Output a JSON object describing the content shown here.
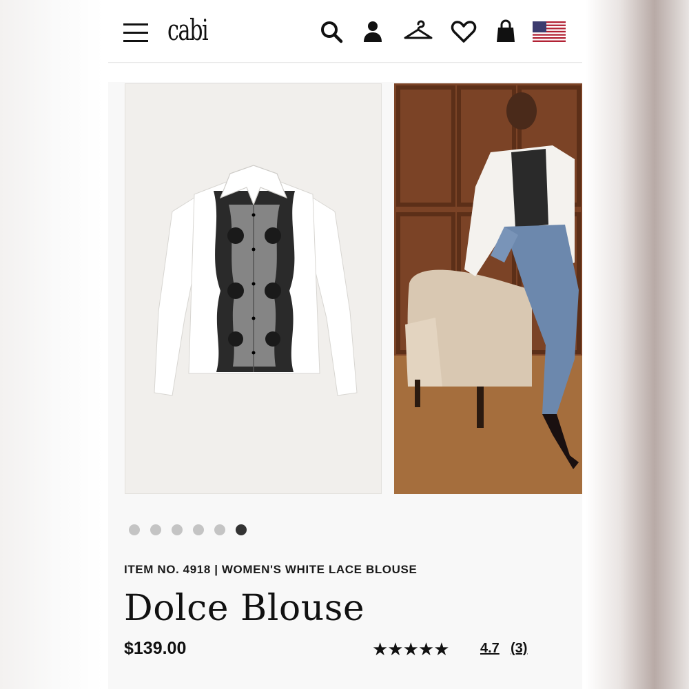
{
  "header": {
    "logo": "cabi",
    "icons": [
      "menu-icon",
      "search-icon",
      "account-icon",
      "hanger-icon",
      "wishlist-icon",
      "bag-icon",
      "us-flag-icon"
    ]
  },
  "gallery": {
    "slide_count": 6,
    "active_index": 5
  },
  "product": {
    "meta": "ITEM NO. 4918 | WOMEN'S WHITE LACE BLOUSE",
    "name": "Dolce Blouse",
    "price": "$139.00",
    "stars": "★★★★★",
    "rating_value": 4.7,
    "rating": "4.7",
    "review_count": "(3)"
  },
  "colors": {
    "text": "#111111",
    "dot_inactive": "#c4c4c4",
    "dot_active": "#333333"
  }
}
